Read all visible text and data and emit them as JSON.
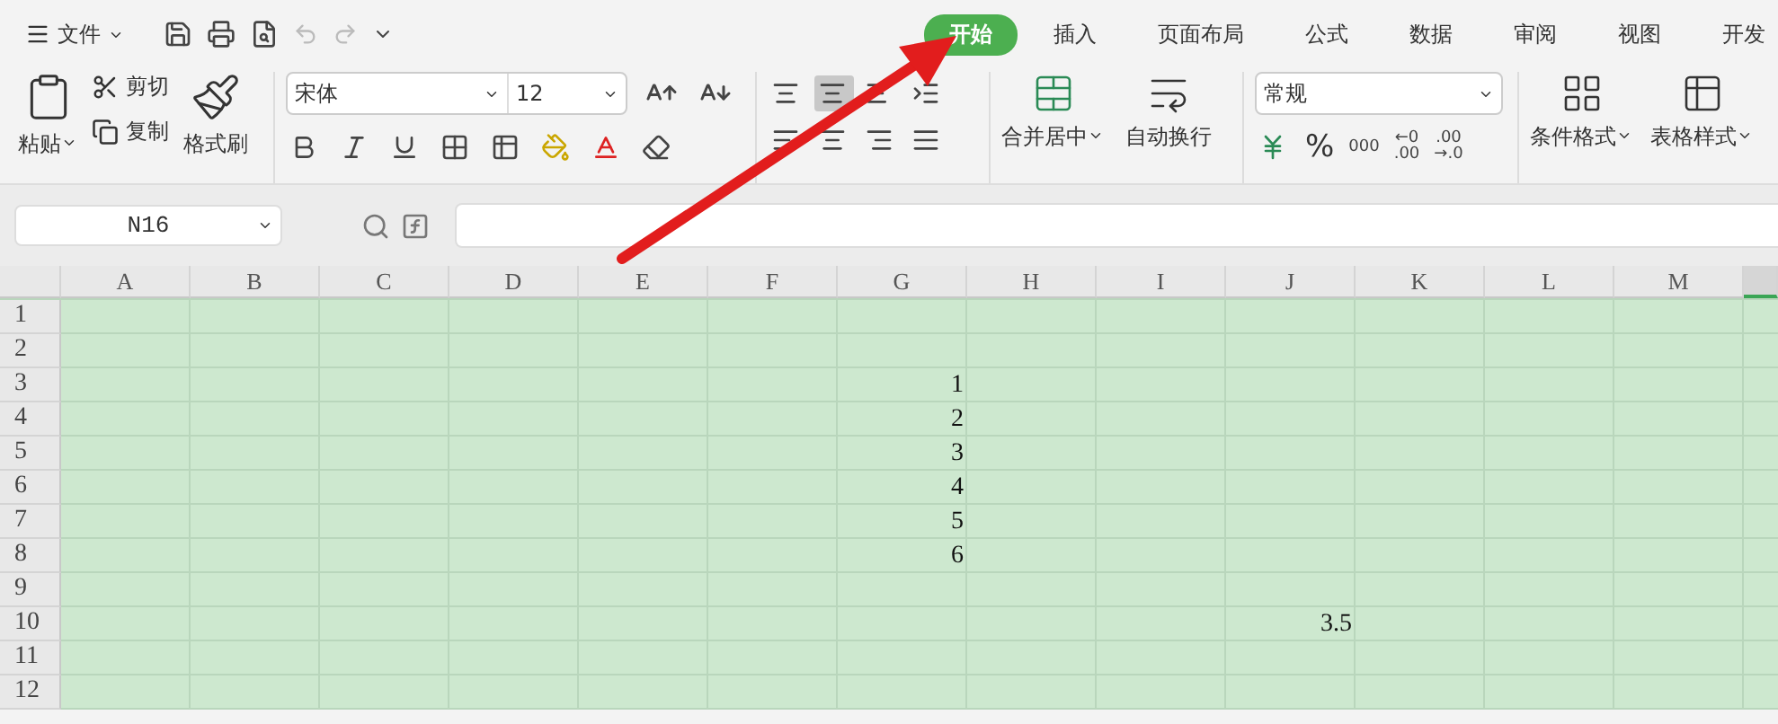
{
  "menu": {
    "label": "文件"
  },
  "tabs": [
    {
      "label": "开始",
      "selected": true
    },
    {
      "label": "插入",
      "selected": false
    },
    {
      "label": "页面布局",
      "selected": false
    },
    {
      "label": "公式",
      "selected": false
    },
    {
      "label": "数据",
      "selected": false
    },
    {
      "label": "审阅",
      "selected": false
    },
    {
      "label": "视图",
      "selected": false
    },
    {
      "label": "开发",
      "selected": false
    }
  ],
  "clipboard": {
    "paste": "粘贴",
    "cut": "剪切",
    "copy": "复制",
    "format_painter": "格式刷"
  },
  "font": {
    "name": "宋体",
    "size": "12"
  },
  "alignment": {
    "selected": [
      false,
      true,
      false,
      false,
      false,
      false,
      false,
      false
    ],
    "merge": "合并居中",
    "wrap": "自动换行"
  },
  "number": {
    "format": "常规",
    "percent": "%",
    "thousands": "000",
    "add_decimal": [
      "←0",
      ".00"
    ],
    "remove_decimal": [
      ".00",
      "→.0"
    ]
  },
  "styles": {
    "conditional": "条件格式",
    "table_style": "表格样式"
  },
  "formula_bar": {
    "name_box": "N16"
  },
  "columns": [
    "A",
    "B",
    "C",
    "D",
    "E",
    "F",
    "G",
    "H",
    "I",
    "J",
    "K",
    "L",
    "M"
  ],
  "rows": [
    {
      "label": "1",
      "cells": []
    },
    {
      "label": "2",
      "cells": []
    },
    {
      "label": "3",
      "cells": [
        null,
        null,
        null,
        null,
        null,
        null,
        "1"
      ]
    },
    {
      "label": "4",
      "cells": [
        null,
        null,
        null,
        null,
        null,
        null,
        "2"
      ]
    },
    {
      "label": "5",
      "cells": [
        null,
        null,
        null,
        null,
        null,
        null,
        "3"
      ]
    },
    {
      "label": "6",
      "cells": [
        null,
        null,
        null,
        null,
        null,
        null,
        "4"
      ]
    },
    {
      "label": "7",
      "cells": [
        null,
        null,
        null,
        null,
        null,
        null,
        "5"
      ]
    },
    {
      "label": "8",
      "cells": [
        null,
        null,
        null,
        null,
        null,
        null,
        "6"
      ]
    },
    {
      "label": "9",
      "cells": []
    },
    {
      "label": "10",
      "cells": [
        null,
        null,
        null,
        null,
        null,
        null,
        null,
        null,
        null,
        "3.5"
      ]
    },
    {
      "label": "11",
      "cells": []
    },
    {
      "label": "12",
      "cells": []
    }
  ]
}
